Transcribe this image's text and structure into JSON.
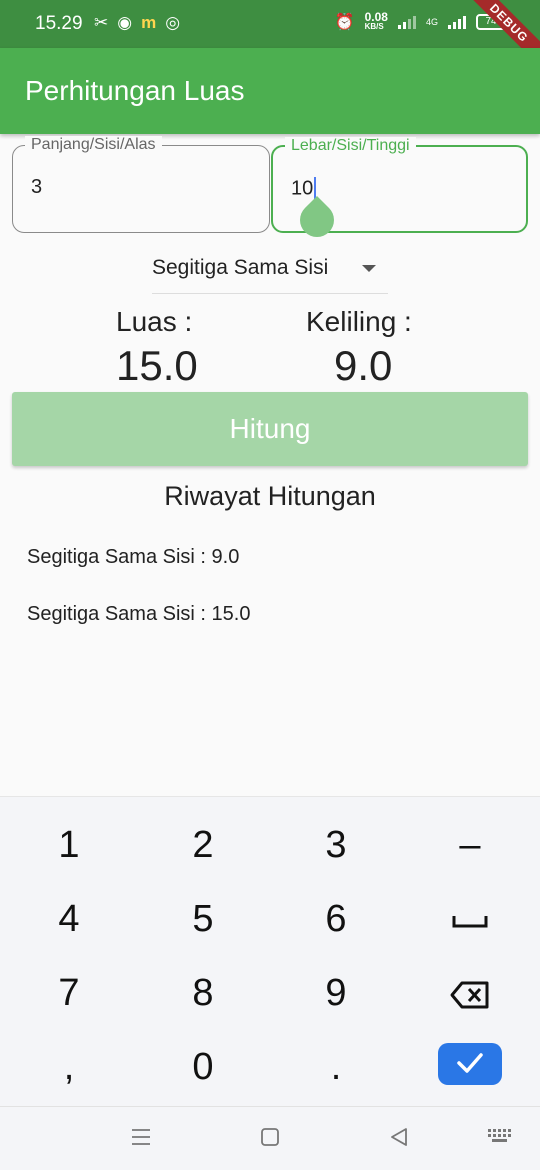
{
  "status_bar": {
    "time": "15.29",
    "speed_value": "0.08",
    "speed_unit": "KB/S",
    "network": "4G",
    "battery": "74",
    "debug_banner": "DEBUG"
  },
  "app_bar": {
    "title": "Perhitungan Luas"
  },
  "inputs": {
    "panjang": {
      "label": "Panjang/Sisi/Alas",
      "value": "3"
    },
    "lebar": {
      "label": "Lebar/Sisi/Tinggi",
      "value": "10"
    }
  },
  "dropdown": {
    "selected": "Segitiga Sama Sisi"
  },
  "results": {
    "luas_label": "Luas :",
    "luas_value": "15.0",
    "keliling_label": "Keliling :",
    "keliling_value": "9.0"
  },
  "button": {
    "label": "Hitung"
  },
  "history": {
    "title": "Riwayat Hitungan",
    "items": [
      "Segitiga Sama Sisi : 9.0",
      "Segitiga Sama Sisi : 15.0"
    ]
  },
  "keyboard": {
    "row1": [
      "1",
      "2",
      "3",
      "–"
    ],
    "row2": [
      "4",
      "5",
      "6"
    ],
    "row3": [
      "7",
      "8",
      "9"
    ],
    "row4": [
      ",",
      "0",
      "."
    ],
    "icons": [
      "space-icon",
      "backspace-icon",
      "done-check-icon"
    ]
  },
  "nav_bar": {
    "icons": [
      "menu-icon",
      "home-icon",
      "back-icon",
      "keyboard-icon"
    ]
  },
  "colors": {
    "primary": "#4caf50",
    "status_bar": "#3e8e41",
    "button_disabled": "#a5d6a7",
    "keyboard_ok": "#2a77e6",
    "debug": "#a52a2a"
  }
}
